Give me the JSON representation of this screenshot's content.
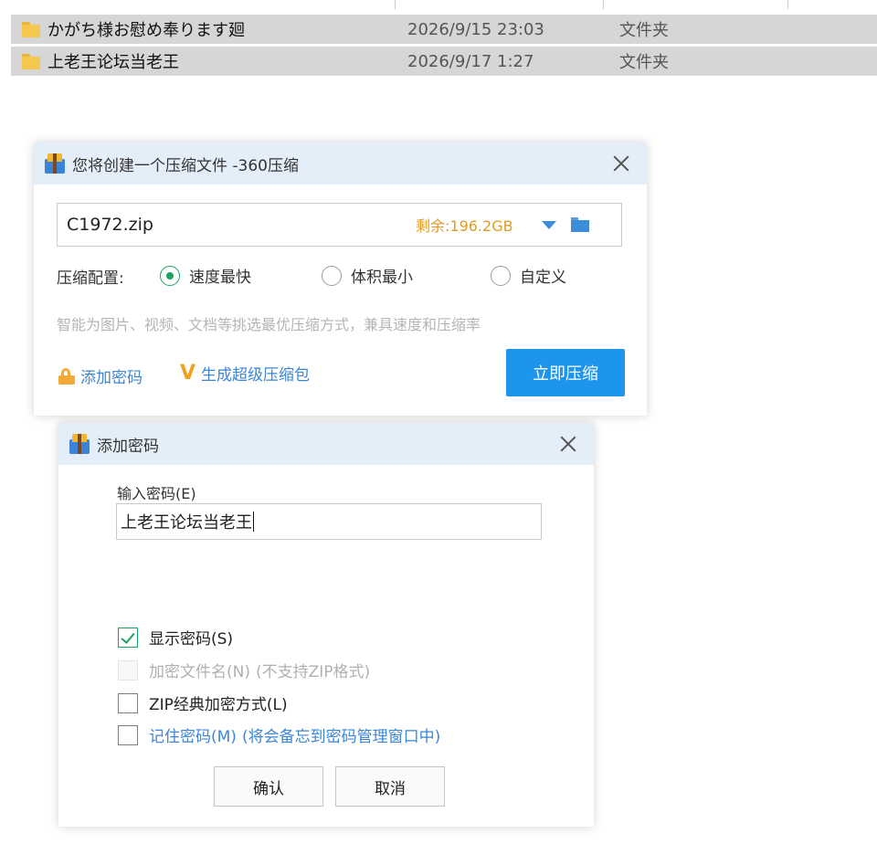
{
  "file_list": {
    "rows": [
      {
        "name": "かがち様お慰め奉ります廻",
        "date": "2026/9/15 23:03",
        "type": "文件夹"
      },
      {
        "name": "上老王论坛当老王",
        "date": "2026/9/17 1:27",
        "type": "文件夹"
      }
    ]
  },
  "compress_dialog": {
    "title": "您将创建一个压缩文件 -360压缩",
    "filename": "C1972.zip",
    "remaining": "剩余:196.2GB",
    "config_label": "压缩配置:",
    "options": [
      "速度最快",
      "体积最小",
      "自定义"
    ],
    "selected_option": "速度最快",
    "hint": "智能为图片、视频、文档等挑选最优压缩方式，兼具速度和压缩率",
    "add_password_link": "添加密码",
    "super_pack_link": "生成超级压缩包",
    "compress_button": "立即压缩",
    "colors": {
      "accent": "#1e95ec",
      "remaining": "#e29a24",
      "radio_on": "#1aa260"
    }
  },
  "password_dialog": {
    "title": "添加密码",
    "input_label": "输入密码(E)",
    "password_value": "上老王论坛当老王",
    "checkboxes": [
      {
        "label": "显示密码(S)",
        "checked": true,
        "enabled": true
      },
      {
        "label": "加密文件名(N)",
        "note": "(不支持ZIP格式)",
        "checked": false,
        "enabled": false
      },
      {
        "label": "ZIP经典加密方式(L)",
        "checked": false,
        "enabled": true
      },
      {
        "label": "记住密码(M)",
        "note": "(将会备忘到密码管理窗口中)",
        "checked": false,
        "enabled": true
      }
    ],
    "ok_button": "确认",
    "cancel_button": "取消"
  },
  "icons": [
    "folder-icon",
    "archive-app-icon",
    "close-icon",
    "dropdown-arrow-icon",
    "browse-folder-icon",
    "lock-icon",
    "v-badge-icon",
    "checkmark-icon"
  ]
}
